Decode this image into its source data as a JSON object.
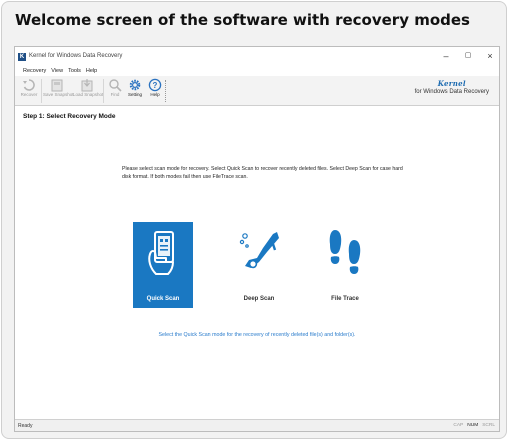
{
  "caption": "Welcome screen of the software with recovery modes",
  "window": {
    "title": "Kernel for Windows Data Recovery",
    "icon_letter": "K",
    "controls": {
      "minimize": "–",
      "restore": "▢",
      "close": "×"
    }
  },
  "menu": [
    "Recovery",
    "View",
    "Tools",
    "Help"
  ],
  "toolbar": [
    {
      "label": "Recover",
      "icon": "recover-icon",
      "enabled": false
    },
    {
      "label": "Save Snapshot",
      "icon": "save-snapshot-icon",
      "enabled": false
    },
    {
      "label": "Load Snapshot",
      "icon": "load-snapshot-icon",
      "enabled": false
    },
    {
      "label": "Find",
      "icon": "find-icon",
      "enabled": false
    },
    {
      "label": "Setting",
      "icon": "gear-icon",
      "enabled": true
    },
    {
      "label": "Help",
      "icon": "help-icon",
      "enabled": true
    }
  ],
  "brand": {
    "name": "Kernel",
    "subtitle": "for Windows Data Recovery",
    "color": "#1b6ab0"
  },
  "content": {
    "step_title": "Step 1: Select Recovery Mode",
    "instructions": "Please select scan mode for recovery. Select Quick Scan to recover recently deleted files. Select Deep Scan for case hard disk format. If both modes fail then use FileTrace scan.",
    "modes": [
      {
        "label": "Quick Scan",
        "icon": "phone-hand-icon",
        "selected": true
      },
      {
        "label": "Deep Scan",
        "icon": "diver-icon",
        "selected": false
      },
      {
        "label": "File Trace",
        "icon": "footprints-icon",
        "selected": false
      }
    ],
    "hint": "Select the Quick Scan mode for the recovery of recently deleted file(s) and folder(s).",
    "accent": "#1a78c2"
  },
  "status": {
    "left": "Ready",
    "indicators": [
      {
        "label": "CAP",
        "on": false
      },
      {
        "label": "NUM",
        "on": true
      },
      {
        "label": "SCRL",
        "on": false
      }
    ]
  }
}
